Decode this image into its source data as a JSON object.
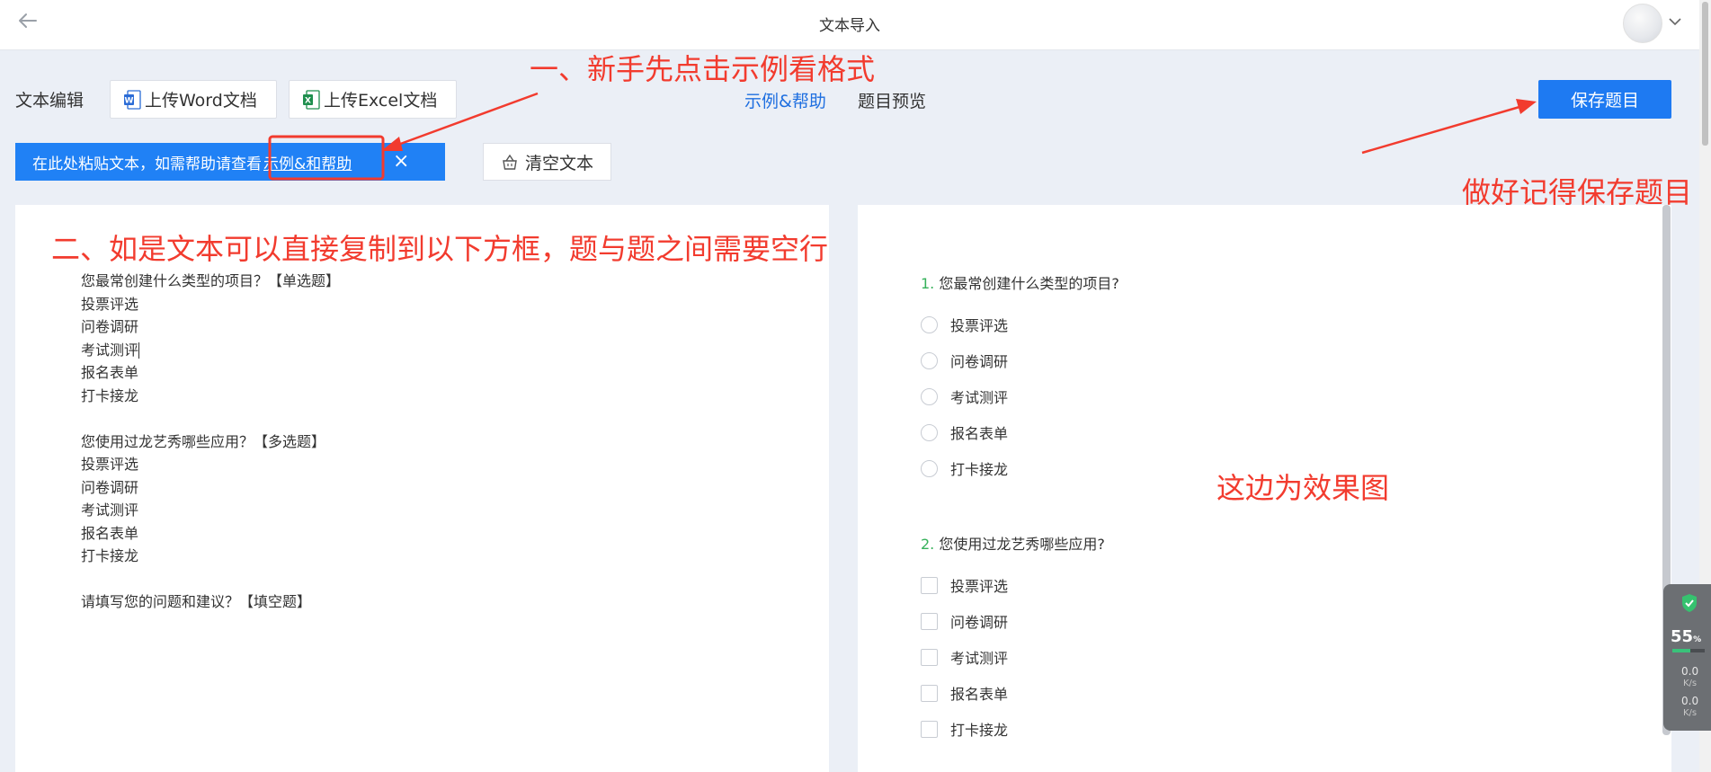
{
  "topbar": {
    "title": "文本导入"
  },
  "toolbar": {
    "label": "文本编辑",
    "upload_word": "上传Word文档",
    "upload_excel": "上传Excel文档",
    "help_link": "示例&帮助",
    "preview_link": "题目预览",
    "save_label": "保存题目"
  },
  "tip": {
    "text": "在此处粘贴文本，如需帮助请查看",
    "link": "示例&和帮助",
    "close": "×"
  },
  "clear_button": "清空文本",
  "editor": {
    "lines": [
      "您最常创建什么类型的项目？【单选题】",
      "投票评选",
      "问卷调研",
      "考试测评",
      "报名表单",
      "打卡接龙",
      "",
      "您使用过龙艺秀哪些应用？【多选题】",
      "投票评选",
      "问卷调研",
      "考试测评",
      "报名表单",
      "打卡接龙",
      "",
      "请填写您的问题和建议？【填空题】"
    ]
  },
  "preview": {
    "q1": {
      "num": "1.",
      "title": "您最常创建什么类型的项目?",
      "options": [
        "投票评选",
        "问卷调研",
        "考试测评",
        "报名表单",
        "打卡接龙"
      ]
    },
    "q2": {
      "num": "2.",
      "title": "您使用过龙艺秀哪些应用?",
      "options": [
        "投票评选",
        "问卷调研",
        "考试测评",
        "报名表单",
        "打卡接龙"
      ]
    }
  },
  "annotations": {
    "step1": "一、新手先点击示例看格式",
    "step2": "二、如是文本可以直接复制到以下方框，题与题之间需要空行",
    "save_hint": "做好记得保存题目",
    "preview_hint": "这边为效果图",
    "color": "#f23b2e"
  },
  "widget": {
    "percent": "55",
    "percent_unit": "%",
    "up": "0.0",
    "down": "0.0",
    "unit": "K/s"
  },
  "colors": {
    "primary": "#1e7af2",
    "tip": "#2081f5",
    "accent_num": "#35b15a",
    "background": "#ebeff6"
  }
}
